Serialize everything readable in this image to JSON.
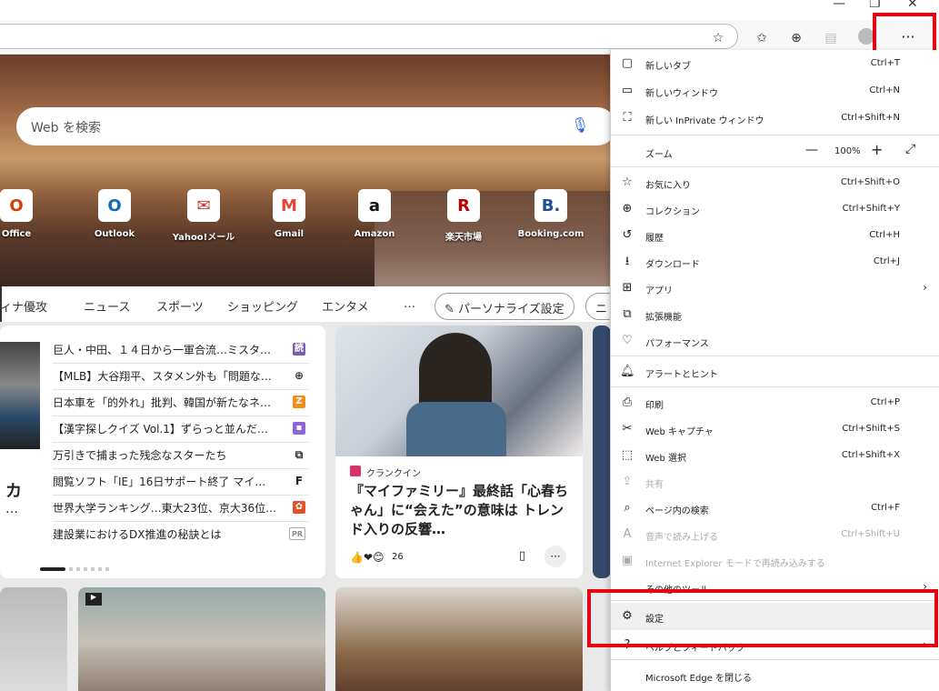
{
  "toolbar": {
    "more_label": "···"
  },
  "search": {
    "placeholder": "Web を検索"
  },
  "tiles": [
    {
      "label": "Office",
      "glyph": "O",
      "color": "#d83b01"
    },
    {
      "label": "Outlook",
      "glyph": "O",
      "color": "#0f6cbd"
    },
    {
      "label": "Yahoo!メール",
      "glyph": "✉",
      "color": "#c0392b"
    },
    {
      "label": "Gmail",
      "glyph": "M",
      "color": "#ea4335"
    },
    {
      "label": "Amazon",
      "glyph": "a",
      "color": "#111111"
    },
    {
      "label": "楽天市場",
      "glyph": "R",
      "color": "#bf0000"
    },
    {
      "label": "Booking.com",
      "glyph": "B.",
      "color": "#1f4e9b"
    }
  ],
  "nav": {
    "items": [
      "ィナ優攻",
      "ニュース",
      "スポーツ",
      "ショッピング",
      "エンタメ",
      "…"
    ],
    "personalize": "パーソナライズ設定",
    "extra": "ニ"
  },
  "news_list": [
    {
      "title": "巨人・中田、１４日から一軍合流…ミスタ…",
      "icon": "読",
      "icon_color": "#7a5fb0"
    },
    {
      "title": "【MLB】大谷翔平、スタメン外も「問題な…",
      "icon": "⊕",
      "icon_color": "#333333"
    },
    {
      "title": "日本車を「的外れ」批判、韓国が新たなネ…",
      "icon": "Z",
      "icon_color": "#f28c1b"
    },
    {
      "title": "【漢字探しクイズ Vol.1】ずらっと並んだ…",
      "icon": "▪",
      "icon_color": "#8e66d4"
    },
    {
      "title": "万引きで捕まった残念なスターたち",
      "icon": "⧉",
      "icon_color": "#333333"
    },
    {
      "title": "閲覧ソフト「IE」16日サポート終了 マイ…",
      "icon": "F",
      "icon_color": "#222222"
    },
    {
      "title": "世界大学ランキング…東大23位、京大36位…",
      "icon": "✿",
      "icon_color": "#e0502a"
    },
    {
      "title": "建設業におけるDX推進の秘訣とは",
      "icon": "PR",
      "icon_color": "#888888"
    }
  ],
  "left_card_fragment": {
    "line1": "カ",
    "line2": "…"
  },
  "feature_card": {
    "source": "クランクイン",
    "title": "『マイファミリー』最終話「心春ちゃん」に“会えた”の意味は トレンド入りの反響…",
    "reactions": "26"
  },
  "menu": {
    "new_tab": {
      "label": "新しいタブ",
      "shortcut": "Ctrl+T"
    },
    "new_window": {
      "label": "新しいウィンドウ",
      "shortcut": "Ctrl+N"
    },
    "new_inprivate": {
      "label": "新しい InPrivate ウィンドウ",
      "shortcut": "Ctrl+Shift+N"
    },
    "zoom": {
      "label": "ズーム",
      "minus": "—",
      "value": "100%",
      "plus": "+",
      "fullscreen": "⤢"
    },
    "favorites": {
      "label": "お気に入り",
      "shortcut": "Ctrl+Shift+O"
    },
    "collections": {
      "label": "コレクション",
      "shortcut": "Ctrl+Shift+Y"
    },
    "history": {
      "label": "履歴",
      "shortcut": "Ctrl+H"
    },
    "downloads": {
      "label": "ダウンロード",
      "shortcut": "Ctrl+J"
    },
    "apps": {
      "label": "アプリ",
      "arrow": "›"
    },
    "extensions": {
      "label": "拡張機能"
    },
    "performance": {
      "label": "パフォーマンス"
    },
    "alerts": {
      "label": "アラートとヒント"
    },
    "print": {
      "label": "印刷",
      "shortcut": "Ctrl+P"
    },
    "web_capture": {
      "label": "Web キャプチャ",
      "shortcut": "Ctrl+Shift+S"
    },
    "web_select": {
      "label": "Web 選択",
      "shortcut": "Ctrl+Shift+X"
    },
    "share": {
      "label": "共有"
    },
    "find": {
      "label": "ページ内の検索",
      "shortcut": "Ctrl+F"
    },
    "read_aloud": {
      "label": "音声で読み上げる",
      "shortcut": "Ctrl+Shift+U"
    },
    "ie_mode": {
      "label": "Internet Explorer モードで再読み込みする"
    },
    "more_tools": {
      "label": "その他のツール",
      "arrow": "›"
    },
    "settings": {
      "label": "設定"
    },
    "help": {
      "label": "ヘルプとフィードバック",
      "arrow": "›"
    },
    "close": {
      "label": "Microsoft Edge を閉じる"
    }
  }
}
